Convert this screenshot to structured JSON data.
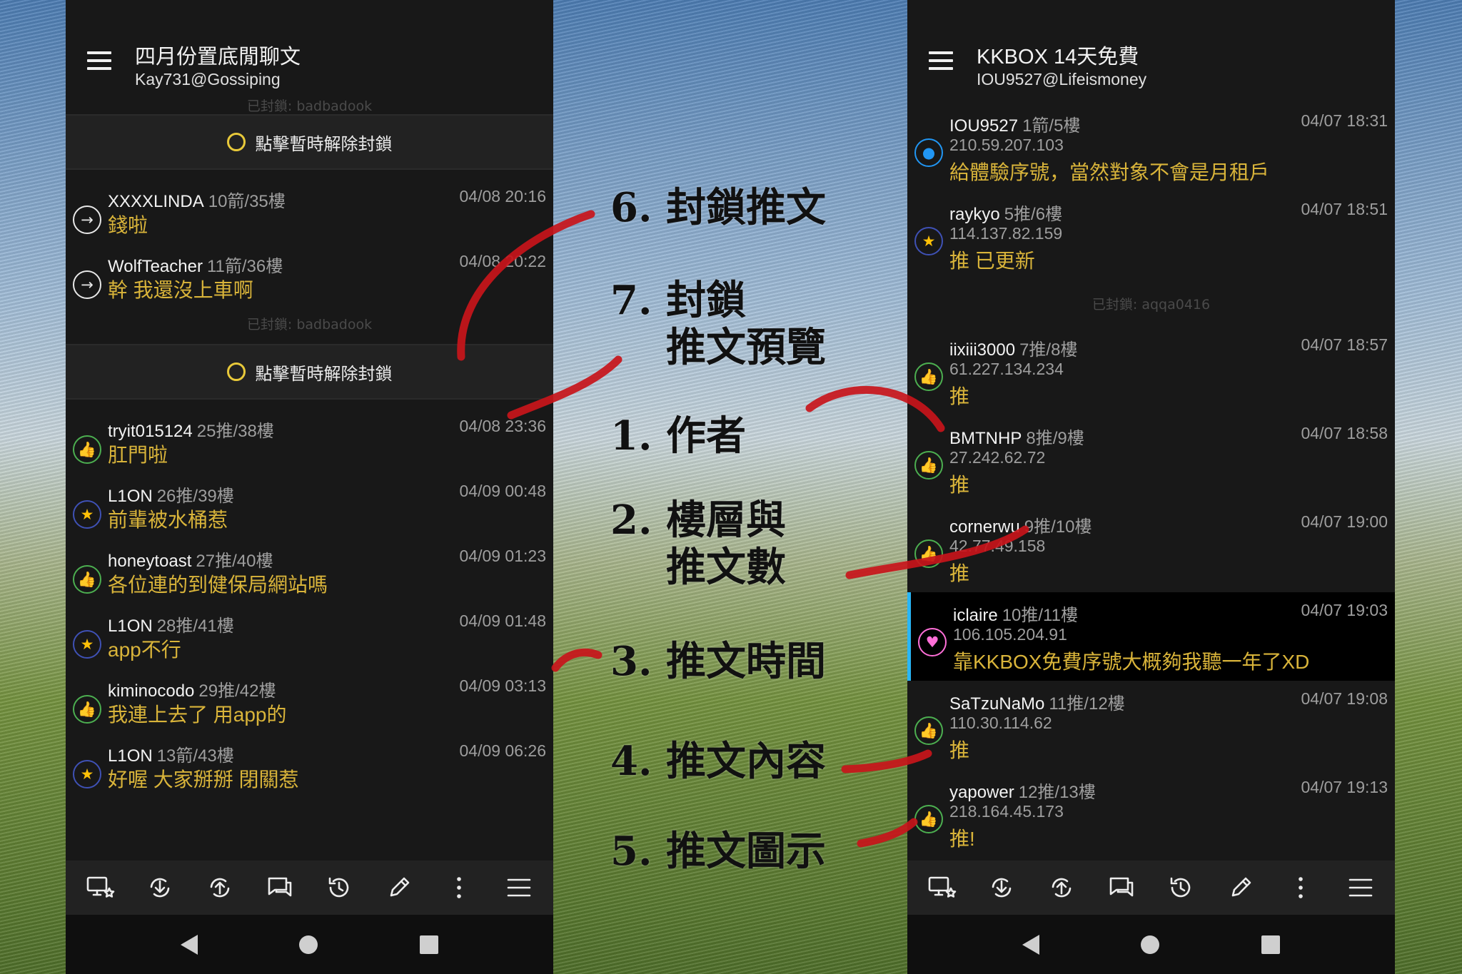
{
  "left_screen": {
    "title": "四月份置底閒聊文",
    "subtitle": "Kay731@Gossiping",
    "blocked_note_1": "已封鎖: badbadook",
    "unblock_label_1": "點擊暫時解除封鎖",
    "comments_a": [
      {
        "icon": "arrow-icon",
        "author": "XXXXLINDA",
        "floor": "10箭/35樓",
        "time": "04/08 20:16",
        "text": "錢啦"
      },
      {
        "icon": "arrow-icon",
        "author": "WolfTeacher",
        "floor": "11箭/36樓",
        "time": "04/08 20:22",
        "text": "幹 我還沒上車啊"
      }
    ],
    "blocked_note_2": "已封鎖: badbadook",
    "unblock_label_2": "點擊暫時解除封鎖",
    "comments_b": [
      {
        "icon": "thumbs-up-icon",
        "author": "tryit015124",
        "floor": "25推/38樓",
        "time": "04/08 23:36",
        "text": "肛門啦"
      },
      {
        "icon": "star-icon",
        "author": "L1ON",
        "floor": "26推/39樓",
        "time": "04/09 00:48",
        "text": "前輩被水桶惹"
      },
      {
        "icon": "thumbs-up-icon",
        "author": "honeytoast",
        "floor": "27推/40樓",
        "time": "04/09 01:23",
        "text": "各位連的到健保局網站嗎"
      },
      {
        "icon": "star-icon",
        "author": "L1ON",
        "floor": "28推/41樓",
        "time": "04/09 01:48",
        "text": "app不行"
      },
      {
        "icon": "thumbs-up-icon",
        "author": "kiminocodo",
        "floor": "29推/42樓",
        "time": "04/09 03:13",
        "text": "我連上去了 用app的"
      },
      {
        "icon": "star-icon",
        "author": "L1ON",
        "floor": "13箭/43樓",
        "time": "04/09 06:26",
        "text": "好喔 大家掰掰 閉關惹"
      }
    ]
  },
  "right_screen": {
    "title": "KKBOX 14天免費",
    "subtitle": "IOU9527@Lifeismoney",
    "comments_a": [
      {
        "icon": "person-icon",
        "author": "IOU9527",
        "floor": "1箭/5樓",
        "time": "04/07 18:31",
        "ip": "210.59.207.103",
        "text": "給體驗序號，當然對象不會是月租戶"
      },
      {
        "icon": "star-icon",
        "author": "raykyo",
        "floor": "5推/6樓",
        "time": "04/07 18:51",
        "ip": "114.137.82.159",
        "text": "推 已更新"
      }
    ],
    "blocked_note": "已封鎖: aqqa0416",
    "comments_b": [
      {
        "icon": "thumbs-up-icon",
        "author": "iixiii3000",
        "floor": "7推/8樓",
        "time": "04/07 18:57",
        "ip": "61.227.134.234",
        "text": "推"
      },
      {
        "icon": "thumbs-up-icon",
        "author": "BMTNHP",
        "floor": "8推/9樓",
        "time": "04/07 18:58",
        "ip": "27.242.62.72",
        "text": "推"
      },
      {
        "icon": "thumbs-up-icon",
        "author": "cornerwu",
        "floor": "9推/10樓",
        "time": "04/07 19:00",
        "ip": "42.77.49.158",
        "text": "推"
      },
      {
        "icon": "heart-icon",
        "author": "iclaire",
        "floor": "10推/11樓",
        "time": "04/07 19:03",
        "ip": "106.105.204.91",
        "text": "靠KKBOX免費序號大概夠我聽一年了XD"
      },
      {
        "icon": "thumbs-up-icon",
        "author": "SaTzuNaMo",
        "floor": "11推/12樓",
        "time": "04/07 19:08",
        "ip": "110.30.114.62",
        "text": "推"
      },
      {
        "icon": "thumbs-up-icon",
        "author": "yapower",
        "floor": "12推/13樓",
        "time": "04/07 19:13",
        "ip": "218.164.45.173",
        "text": "推!"
      }
    ]
  },
  "toolbar_icons": [
    "screen-star-icon",
    "download-refresh-icon",
    "upload-refresh-icon",
    "chat-icon",
    "history-icon",
    "pencil-icon",
    "more-vert-icon",
    "menu-icon"
  ],
  "annotations": {
    "a6": "6. 封鎖推文",
    "a7": "7. 封鎖\n    推文預覽",
    "a1": "1. 作者",
    "a2": "2. 樓層與\n    推文數",
    "a3": "3. 推文時間",
    "a4": "4. 推文內容",
    "a5": "5. 推文圖示"
  },
  "colors": {
    "push_text": "#d9b43a",
    "icon_green": "#4caf50",
    "highlight_bar": "#29b6f6",
    "arrow_red": "#c8151b"
  }
}
